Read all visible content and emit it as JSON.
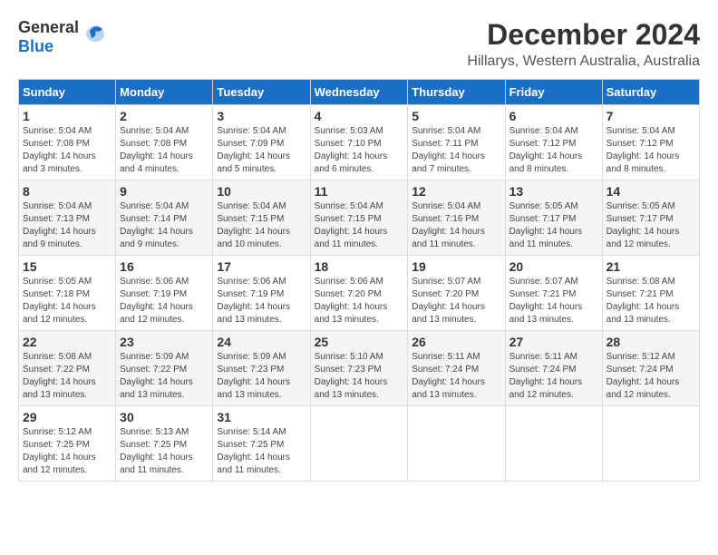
{
  "logo": {
    "general": "General",
    "blue": "Blue"
  },
  "title": "December 2024",
  "subtitle": "Hillarys, Western Australia, Australia",
  "headers": [
    "Sunday",
    "Monday",
    "Tuesday",
    "Wednesday",
    "Thursday",
    "Friday",
    "Saturday"
  ],
  "weeks": [
    [
      {
        "day": "1",
        "sunrise": "5:04 AM",
        "sunset": "7:08 PM",
        "daylight": "14 hours and 3 minutes."
      },
      {
        "day": "2",
        "sunrise": "5:04 AM",
        "sunset": "7:08 PM",
        "daylight": "14 hours and 4 minutes."
      },
      {
        "day": "3",
        "sunrise": "5:04 AM",
        "sunset": "7:09 PM",
        "daylight": "14 hours and 5 minutes."
      },
      {
        "day": "4",
        "sunrise": "5:03 AM",
        "sunset": "7:10 PM",
        "daylight": "14 hours and 6 minutes."
      },
      {
        "day": "5",
        "sunrise": "5:04 AM",
        "sunset": "7:11 PM",
        "daylight": "14 hours and 7 minutes."
      },
      {
        "day": "6",
        "sunrise": "5:04 AM",
        "sunset": "7:12 PM",
        "daylight": "14 hours and 8 minutes."
      },
      {
        "day": "7",
        "sunrise": "5:04 AM",
        "sunset": "7:12 PM",
        "daylight": "14 hours and 8 minutes."
      }
    ],
    [
      {
        "day": "8",
        "sunrise": "5:04 AM",
        "sunset": "7:13 PM",
        "daylight": "14 hours and 9 minutes."
      },
      {
        "day": "9",
        "sunrise": "5:04 AM",
        "sunset": "7:14 PM",
        "daylight": "14 hours and 9 minutes."
      },
      {
        "day": "10",
        "sunrise": "5:04 AM",
        "sunset": "7:15 PM",
        "daylight": "14 hours and 10 minutes."
      },
      {
        "day": "11",
        "sunrise": "5:04 AM",
        "sunset": "7:15 PM",
        "daylight": "14 hours and 11 minutes."
      },
      {
        "day": "12",
        "sunrise": "5:04 AM",
        "sunset": "7:16 PM",
        "daylight": "14 hours and 11 minutes."
      },
      {
        "day": "13",
        "sunrise": "5:05 AM",
        "sunset": "7:17 PM",
        "daylight": "14 hours and 11 minutes."
      },
      {
        "day": "14",
        "sunrise": "5:05 AM",
        "sunset": "7:17 PM",
        "daylight": "14 hours and 12 minutes."
      }
    ],
    [
      {
        "day": "15",
        "sunrise": "5:05 AM",
        "sunset": "7:18 PM",
        "daylight": "14 hours and 12 minutes."
      },
      {
        "day": "16",
        "sunrise": "5:06 AM",
        "sunset": "7:19 PM",
        "daylight": "14 hours and 12 minutes."
      },
      {
        "day": "17",
        "sunrise": "5:06 AM",
        "sunset": "7:19 PM",
        "daylight": "14 hours and 13 minutes."
      },
      {
        "day": "18",
        "sunrise": "5:06 AM",
        "sunset": "7:20 PM",
        "daylight": "14 hours and 13 minutes."
      },
      {
        "day": "19",
        "sunrise": "5:07 AM",
        "sunset": "7:20 PM",
        "daylight": "14 hours and 13 minutes."
      },
      {
        "day": "20",
        "sunrise": "5:07 AM",
        "sunset": "7:21 PM",
        "daylight": "14 hours and 13 minutes."
      },
      {
        "day": "21",
        "sunrise": "5:08 AM",
        "sunset": "7:21 PM",
        "daylight": "14 hours and 13 minutes."
      }
    ],
    [
      {
        "day": "22",
        "sunrise": "5:08 AM",
        "sunset": "7:22 PM",
        "daylight": "14 hours and 13 minutes."
      },
      {
        "day": "23",
        "sunrise": "5:09 AM",
        "sunset": "7:22 PM",
        "daylight": "14 hours and 13 minutes."
      },
      {
        "day": "24",
        "sunrise": "5:09 AM",
        "sunset": "7:23 PM",
        "daylight": "14 hours and 13 minutes."
      },
      {
        "day": "25",
        "sunrise": "5:10 AM",
        "sunset": "7:23 PM",
        "daylight": "14 hours and 13 minutes."
      },
      {
        "day": "26",
        "sunrise": "5:11 AM",
        "sunset": "7:24 PM",
        "daylight": "14 hours and 13 minutes."
      },
      {
        "day": "27",
        "sunrise": "5:11 AM",
        "sunset": "7:24 PM",
        "daylight": "14 hours and 12 minutes."
      },
      {
        "day": "28",
        "sunrise": "5:12 AM",
        "sunset": "7:24 PM",
        "daylight": "14 hours and 12 minutes."
      }
    ],
    [
      {
        "day": "29",
        "sunrise": "5:12 AM",
        "sunset": "7:25 PM",
        "daylight": "14 hours and 12 minutes."
      },
      {
        "day": "30",
        "sunrise": "5:13 AM",
        "sunset": "7:25 PM",
        "daylight": "14 hours and 11 minutes."
      },
      {
        "day": "31",
        "sunrise": "5:14 AM",
        "sunset": "7:25 PM",
        "daylight": "14 hours and 11 minutes."
      },
      null,
      null,
      null,
      null
    ]
  ],
  "labels": {
    "sunrise": "Sunrise:",
    "sunset": "Sunset:",
    "daylight": "Daylight:"
  }
}
